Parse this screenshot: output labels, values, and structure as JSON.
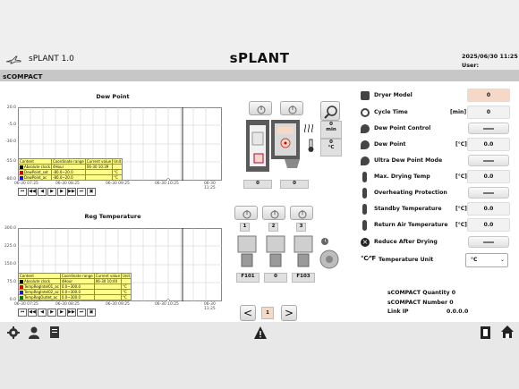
{
  "header": {
    "app_name": "sPLANT 1.0",
    "title": "sPLANT",
    "date_time": "2025/06/30  11:25",
    "user_label": "User:"
  },
  "section": {
    "title": "sCOMPACT"
  },
  "dew_chart": {
    "title": "Dew Point",
    "y_ticks": [
      "20.0",
      "-5.0",
      "-30.0",
      "-55.0",
      "-80.0"
    ],
    "x_ticks": [
      "06-30 07:25",
      "06-30 08:25",
      "06-30 09:25",
      "06-30 10:25",
      "06-30 11:25"
    ],
    "legend_header": [
      "Content",
      "Coordinate range",
      "Current value",
      "Unit"
    ],
    "legend_rows": [
      {
        "name": "Absolute clock",
        "range": "4Hour",
        "value": "06-30 10:39",
        "unit": "",
        "color": "#000000"
      },
      {
        "name": "DewPoint_set",
        "range": "-80.0~20.0",
        "value": "",
        "unit": "°C",
        "color": "#d40000"
      },
      {
        "name": "DewPoint_ac",
        "range": "-80.0~20.0",
        "value": "",
        "unit": "°C",
        "color": "#1a1ad0"
      }
    ]
  },
  "reg_chart": {
    "title": "Reg Temperature",
    "y_ticks": [
      "300.0",
      "225.0",
      "150.0",
      "75.0",
      "0.0"
    ],
    "x_ticks": [
      "06-30 07:25",
      "06-30 08:25",
      "06-30 09:25",
      "06-30 10:25",
      "06-30 11:25"
    ],
    "legend_header": [
      "Content",
      "Coordinate range",
      "Current value",
      "Unit"
    ],
    "legend_rows": [
      {
        "name": "Absolute clock",
        "range": "4Hour",
        "value": "06-30 10:40",
        "unit": "",
        "color": "#000000"
      },
      {
        "name": "TempRegIntel01_ac",
        "range": "0.0~300.0",
        "value": "",
        "unit": "°C",
        "color": "#d40000"
      },
      {
        "name": "TempRegIntel02_ac",
        "range": "0.0~300.0",
        "value": "",
        "unit": "°C",
        "color": "#1a1ad0"
      },
      {
        "name": "TempRegOutlet_ac",
        "range": "0.0~300.0",
        "value": "",
        "unit": "°C",
        "color": "#0a7a0a"
      }
    ]
  },
  "dryer": {
    "time_val": "0",
    "time_unit": "min",
    "temp_val": "0",
    "temp_unit": "°C",
    "hopper1": "0",
    "hopper2": "0"
  },
  "blowers": {
    "labels": [
      "1",
      "2",
      "3"
    ],
    "valves": [
      "F101",
      "0",
      "F103"
    ]
  },
  "pager": {
    "page": "1",
    "prev": "<",
    "next": ">"
  },
  "settings": [
    {
      "label": "Dryer Model",
      "unit": "",
      "value": "0",
      "kind": "value"
    },
    {
      "label": "Cycle Time",
      "unit": "[min]",
      "value": "0",
      "kind": "value"
    },
    {
      "label": "Dew Point Control",
      "unit": "",
      "value": "",
      "kind": "toggle"
    },
    {
      "label": "Dew Point",
      "unit": "[°C]",
      "value": "0.0",
      "kind": "value"
    },
    {
      "label": "Ultra Dew Point Mode",
      "unit": "",
      "value": "",
      "kind": "toggle"
    },
    {
      "label": "Max. Drying Temp",
      "unit": "[°C]",
      "value": "0.0",
      "kind": "value"
    },
    {
      "label": "Overheating Protection",
      "unit": "",
      "value": "",
      "kind": "toggle"
    },
    {
      "label": "Standby Temperature",
      "unit": "[°C]",
      "value": "0.0",
      "kind": "value"
    },
    {
      "label": "Return Air Temperature",
      "unit": "[°C]",
      "value": "0.0",
      "kind": "value"
    },
    {
      "label": "Reduce After Drying",
      "unit": "",
      "value": "",
      "kind": "toggle"
    },
    {
      "label": "Temperature Unit",
      "unit": "",
      "value": "°C",
      "kind": "select"
    }
  ],
  "info": [
    {
      "label": "sCOMPACT Quantity",
      "value": "0"
    },
    {
      "label": "sCOMPACT Number",
      "value": "0"
    },
    {
      "label": "Link IP",
      "value": "0.0.0.0"
    }
  ],
  "colors": {
    "accent": "#f6d8c6",
    "legend_bg": "#fffe8a"
  }
}
